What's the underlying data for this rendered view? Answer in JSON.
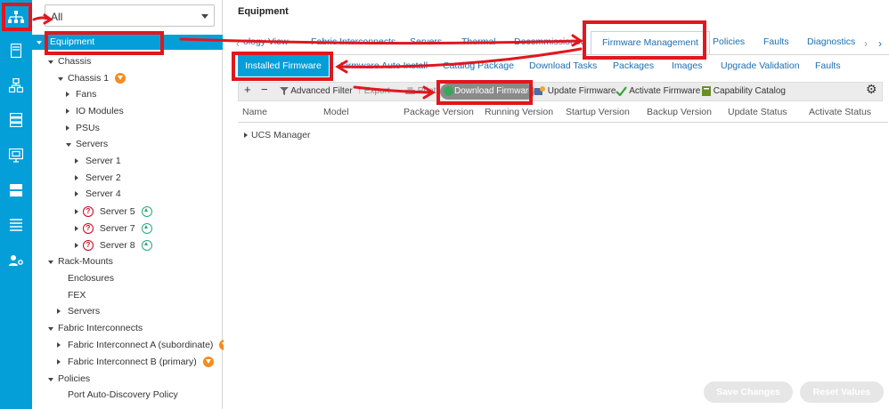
{
  "filter": {
    "value": "All"
  },
  "tree": [
    {
      "label": "Equipment",
      "selected": true
    },
    {
      "label": "Chassis"
    },
    {
      "label": "Chassis 1"
    },
    {
      "label": "Fans"
    },
    {
      "label": "IO Modules"
    },
    {
      "label": "PSUs"
    },
    {
      "label": "Servers"
    },
    {
      "label": "Server 1"
    },
    {
      "label": "Server 2"
    },
    {
      "label": "Server 4"
    },
    {
      "label": "Server 5"
    },
    {
      "label": "Server 7"
    },
    {
      "label": "Server 8"
    },
    {
      "label": "Rack-Mounts"
    },
    {
      "label": "Enclosures"
    },
    {
      "label": "FEX"
    },
    {
      "label": "Servers"
    },
    {
      "label": "Fabric Interconnects"
    },
    {
      "label": "Fabric Interconnect A (subordinate)"
    },
    {
      "label": "Fabric Interconnect B (primary)"
    },
    {
      "label": "Policies"
    },
    {
      "label": "Port Auto-Discovery Policy"
    }
  ],
  "main": {
    "title": "Equipment",
    "top_tabs": [
      "ology View",
      "Fabric Interconnects",
      "Servers",
      "Thermal",
      "Decommissioned",
      "Firmware Management",
      "Policies",
      "Faults",
      "Diagnostics"
    ],
    "active_top_tab": "Firmware Management",
    "sub_tabs": [
      "Installed Firmware",
      "Firmware Auto Install",
      "Catalog Package",
      "Download Tasks",
      "Packages",
      "Images",
      "Upgrade Validation",
      "Faults"
    ],
    "toolbar": {
      "add": "+",
      "remove": "−",
      "advanced_filter": "Advanced Filter",
      "export": "Export",
      "print": "Print",
      "download_firmware": "Download Firmware",
      "update_firmware": "Update Firmware",
      "activate_firmware": "Activate Firmware",
      "capability_catalog": "Capability Catalog"
    },
    "columns": [
      "Name",
      "Model",
      "Package Version",
      "Running Version",
      "Startup Version",
      "Backup Version",
      "Update Status",
      "Activate Status"
    ],
    "rows": [
      {
        "name": "UCS Manager"
      }
    ],
    "footer": {
      "save": "Save Changes",
      "reset": "Reset Values"
    }
  },
  "colors": {
    "accent": "#049fd9",
    "annotation": "#e0171e",
    "link": "#1b6fb1"
  }
}
